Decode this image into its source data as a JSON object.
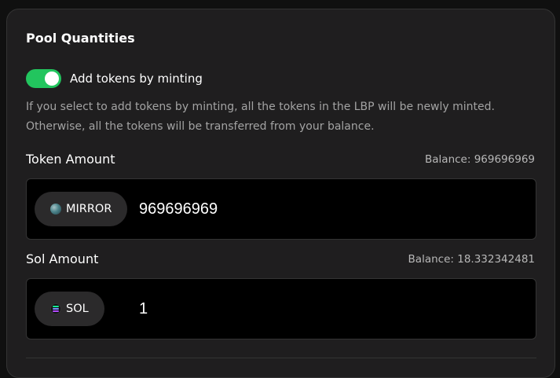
{
  "section": {
    "title": "Pool Quantities"
  },
  "mint_toggle": {
    "label": "Add tokens by minting",
    "enabled": true,
    "color": "#22c55e"
  },
  "description": "If you select to add tokens by minting, all the tokens in the LBP will be newly minted. Otherwise, all the tokens will be transferred from your balance.",
  "token_amount": {
    "label": "Token Amount",
    "balance": "Balance: 969696969",
    "token_name": "MIRROR",
    "token_icon": "mirror-token-icon",
    "value": "969696969"
  },
  "sol_amount": {
    "label": "Sol Amount",
    "balance": "Balance: 18.332342481",
    "token_name": "SOL",
    "token_icon": "sol-token-icon",
    "value": "1"
  }
}
